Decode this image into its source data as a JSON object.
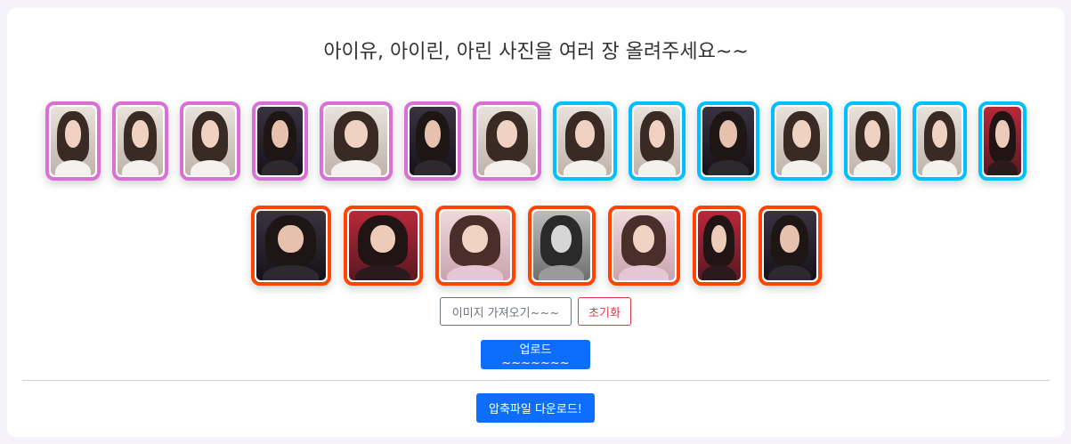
{
  "page": {
    "title": "아이유, 아이린, 아린 사진을 여러 장 올려주세요~~"
  },
  "colors": {
    "arin": "#da70d6",
    "irene": "#00bfff",
    "iu": "#ff4500"
  },
  "row1": [
    {
      "group": "arin",
      "tone": "bright"
    },
    {
      "group": "arin",
      "tone": "bright"
    },
    {
      "group": "arin",
      "tone": "bright"
    },
    {
      "group": "arin",
      "tone": "dark"
    },
    {
      "group": "arin",
      "tone": "bright"
    },
    {
      "group": "arin",
      "tone": "dark"
    },
    {
      "group": "arin",
      "tone": "bright"
    },
    {
      "group": "irene",
      "tone": "bright"
    },
    {
      "group": "irene",
      "tone": "bright"
    },
    {
      "group": "irene",
      "tone": "dark"
    },
    {
      "group": "irene",
      "tone": "bright"
    },
    {
      "group": "irene",
      "tone": "bright"
    },
    {
      "group": "irene",
      "tone": "bright"
    },
    {
      "group": "irene",
      "tone": "red"
    }
  ],
  "row2": [
    {
      "group": "iu",
      "tone": "dark"
    },
    {
      "group": "iu",
      "tone": "red"
    },
    {
      "group": "iu",
      "tone": "pink"
    },
    {
      "group": "iu",
      "tone": "gray"
    },
    {
      "group": "iu",
      "tone": "pink"
    },
    {
      "group": "iu",
      "tone": "red"
    },
    {
      "group": "iu",
      "tone": "dark"
    }
  ],
  "buttons": {
    "load_images": "이미지 가져오기~~~",
    "reset": "초기화",
    "upload": "업로드~~~~~~~",
    "download_zip": "압축파일 다운로드!"
  }
}
